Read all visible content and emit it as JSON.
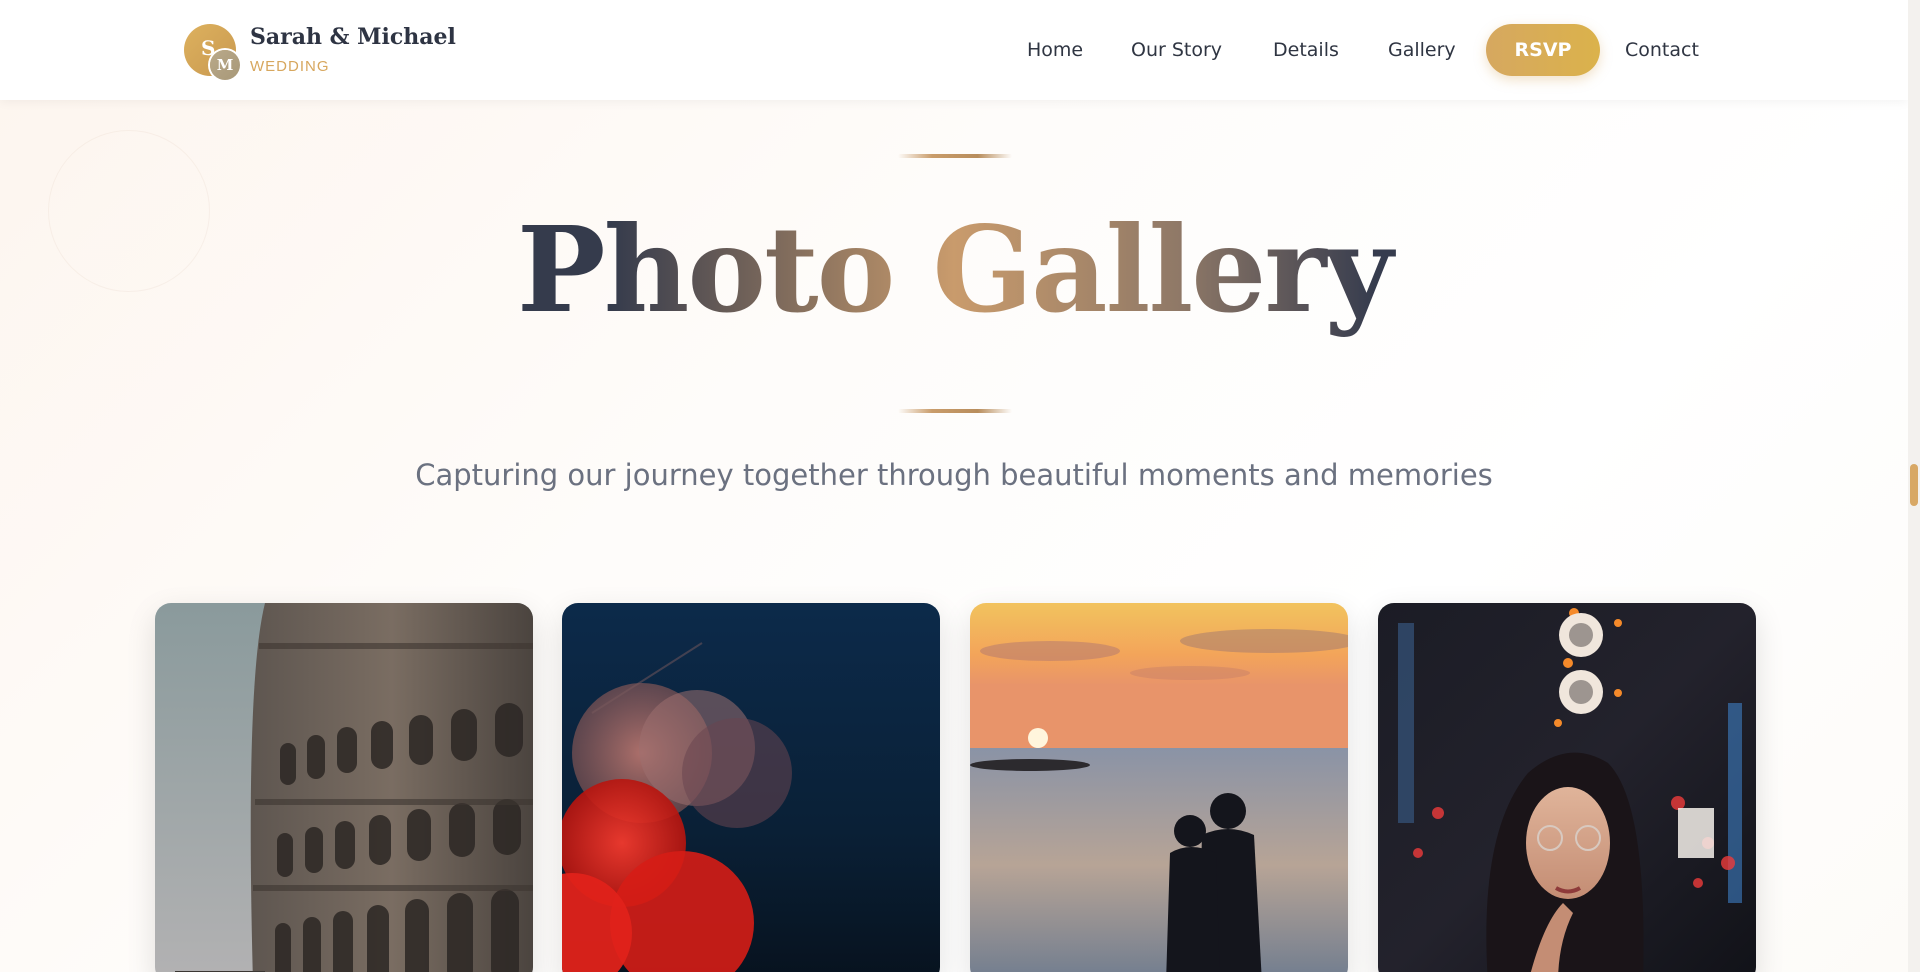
{
  "site": {
    "logo": {
      "initial_1": "S",
      "initial_2": "M",
      "name": "Sarah & Michael",
      "subtitle": "WEDDING"
    }
  },
  "nav": {
    "home": "Home",
    "our_story": "Our Story",
    "details": "Details",
    "gallery": "Gallery",
    "rsvp": "RSVP",
    "contact": "Contact"
  },
  "hero": {
    "title": "Photo Gallery",
    "subtitle": "Capturing our journey together through beautiful moments and memories"
  },
  "gallery": {
    "photos": [
      {
        "subject": "colosseum"
      },
      {
        "subject": "bokeh-lights"
      },
      {
        "subject": "couple-sunset-beach"
      },
      {
        "subject": "woman-city-lights"
      }
    ]
  },
  "colors": {
    "accent_gold": "#d6a860",
    "text_dark": "#2e3443",
    "text_muted": "#6b7180"
  }
}
